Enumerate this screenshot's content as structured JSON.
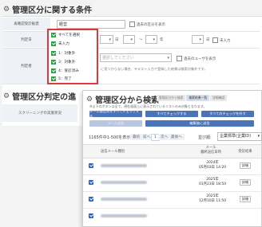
{
  "back": {
    "title": "管理区分に関する条件",
    "section2_title": "管理区分判定の進",
    "rows": {
      "r1_label": "再確認受診勧奨",
      "r1_value": "経営",
      "r1_checkbox_label": "過去の区分を表示",
      "r2_label": "判定日",
      "r2_day_label": "日",
      "r2_tilde": "〜",
      "r2_year_label": "年",
      "r2_day_label2": "日",
      "r2_unentered": "未入力",
      "r3_label": "判定者",
      "r3_placeholder": "選択してください",
      "r3_checkbox_label": "過去のユーザを表示",
      "r3_note": "に見つからない場合、テキスト入力で登録した結果は検索対象外です。",
      "r4_label": "スクリーニングの実施状況"
    },
    "dropdown_items": [
      "すべてを選択",
      "未入力",
      "1：対象外",
      "3：対象外",
      "4：受診済み",
      "5：完了"
    ]
  },
  "front": {
    "title": "管理区分から検索",
    "tabs": [
      "管理区分から検索",
      "検索結果一覧",
      "詳細確認"
    ],
    "description": "※以下のボタンは全て、現在画面上に表示されているリストのみ対象となります。",
    "buttons": {
      "mail_all": "メール送信先をすべてチェックする",
      "check_all": "すべてチェックする",
      "uncheck_all": "すべてのチェックを外す",
      "mail_bulk": "メール送信",
      "edit_bulk": "編集後に送信"
    },
    "pagination": {
      "count": "1165件中1-500を表示",
      "first": "最初",
      "prev": "前へ",
      "current": "1",
      "next": "次へ",
      "last": "最後へ"
    },
    "sort": {
      "label": "並び順:",
      "value": "企業標準(企業ID)"
    },
    "table": {
      "headers": [
        "",
        "送信メール種別",
        "メール\n最終送信日時",
        "受診結果"
      ],
      "rows": [
        {
          "date": "2024年\n05月03日 14:20",
          "action": "詳細"
        },
        {
          "date": "2025年\n01月23日 18:50",
          "action": "詳細"
        },
        {
          "date": "2025年\n12月10日 11:50",
          "action": "詳細"
        }
      ]
    }
  }
}
